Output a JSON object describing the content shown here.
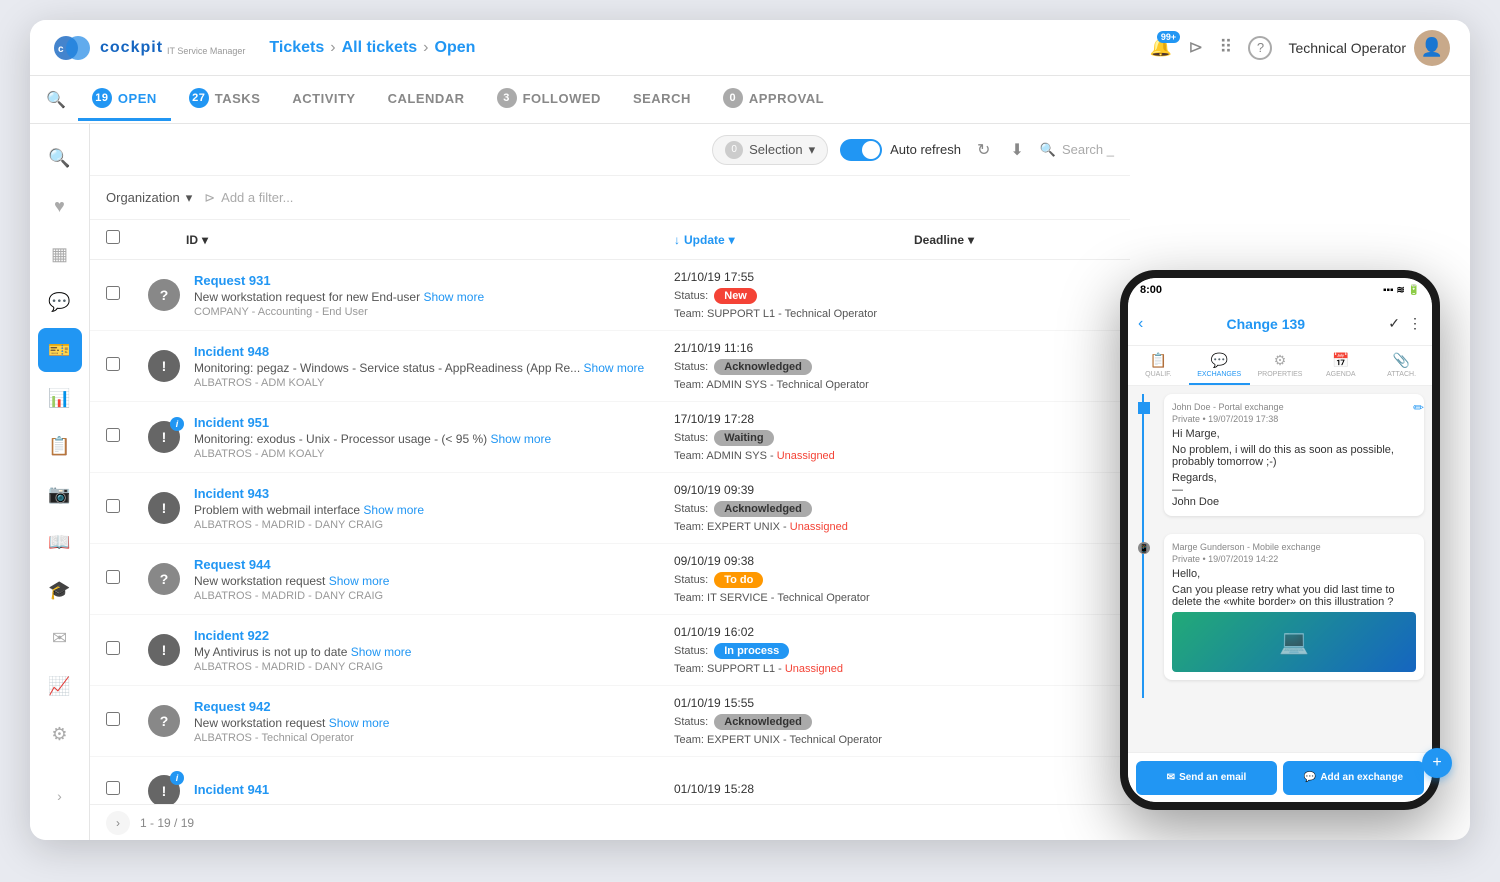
{
  "app": {
    "title": "cockpit IT Service Manager",
    "breadcrumb": {
      "part1": "Tickets",
      "part2": "All tickets",
      "part3": "Open"
    }
  },
  "header": {
    "notification_badge": "99+",
    "user_name": "Technical Operator"
  },
  "nav": {
    "tabs": [
      {
        "id": "open",
        "label": "OPEN",
        "badge": "19",
        "active": true
      },
      {
        "id": "tasks",
        "label": "TASKS",
        "badge": "27",
        "active": false
      },
      {
        "id": "activity",
        "label": "ACTIVITY",
        "badge": "",
        "active": false
      },
      {
        "id": "calendar",
        "label": "CALENDAR",
        "badge": "",
        "active": false
      },
      {
        "id": "followed",
        "label": "FOLLOWED",
        "badge": "3",
        "active": false
      },
      {
        "id": "search",
        "label": "SEARCH",
        "badge": "",
        "active": false
      },
      {
        "id": "approval",
        "label": "APPROVAL",
        "badge": "0",
        "active": false
      }
    ]
  },
  "toolbar": {
    "selection_label": "Selection",
    "selection_count": "0",
    "auto_refresh_label": "Auto refresh",
    "search_placeholder": "Search _"
  },
  "filter": {
    "org_label": "Organization",
    "add_filter_label": "Add a filter..."
  },
  "table": {
    "col_id": "ID",
    "col_update": "Update",
    "col_deadline": "Deadline",
    "tickets": [
      {
        "id": "Request 931",
        "avatar_type": "question",
        "desc": "New workstation request for new End-user Show more",
        "org": "COMPANY - Accounting - End User",
        "date": "21/10/19 17:55",
        "status": "New",
        "status_type": "new",
        "team": "SUPPORT L1 - Technical Operator",
        "unassigned": false
      },
      {
        "id": "Incident 948",
        "avatar_type": "exclamation",
        "desc": "Monitoring: pegaz - Windows - Service status - AppReadiness (App Re... Show more",
        "org": "ALBATROS - ADM KOALY",
        "date": "21/10/19 11:16",
        "status": "Acknowledged",
        "status_type": "acknowledged",
        "team": "ADMIN SYS - Technical Operator",
        "unassigned": false
      },
      {
        "id": "Incident 951",
        "avatar_type": "exclamation",
        "info_badge": true,
        "desc": "Monitoring: exodus - Unix - Processor usage - (< 95 %) Show more",
        "org": "ALBATROS - ADM KOALY",
        "date": "17/10/19 17:28",
        "status": "Waiting",
        "status_type": "waiting",
        "team": "ADMIN SYS - Unassigned",
        "unassigned": true
      },
      {
        "id": "Incident 943",
        "avatar_type": "exclamation",
        "desc": "Problem with webmail interface Show more",
        "org": "ALBATROS - MADRID - DANY CRAIG",
        "date": "09/10/19 09:39",
        "status": "Acknowledged",
        "status_type": "acknowledged",
        "team": "EXPERT UNIX - Unassigned",
        "unassigned": true
      },
      {
        "id": "Request 944",
        "avatar_type": "question",
        "desc": "New workstation request Show more",
        "org": "ALBATROS - MADRID - DANY CRAIG",
        "date": "09/10/19 09:38",
        "status": "To do",
        "status_type": "todo",
        "team": "IT SERVICE - Technical Operator",
        "unassigned": false
      },
      {
        "id": "Incident 922",
        "avatar_type": "exclamation",
        "desc": "My Antivirus is not up to date Show more",
        "org": "ALBATROS - MADRID - DANY CRAIG",
        "date": "01/10/19 16:02",
        "status": "In process",
        "status_type": "inprocess",
        "team": "SUPPORT L1 - Unassigned",
        "unassigned": true
      },
      {
        "id": "Request 942",
        "avatar_type": "question",
        "desc": "New workstation request Show more",
        "org": "ALBATROS - Technical Operator",
        "date": "01/10/19 15:55",
        "status": "Acknowledged",
        "status_type": "acknowledged",
        "team": "EXPERT UNIX - Technical Operator",
        "unassigned": false
      },
      {
        "id": "Incident 941",
        "avatar_type": "exclamation",
        "info_badge": true,
        "desc": "",
        "org": "",
        "date": "01/10/19 15:28",
        "status": "",
        "status_type": "",
        "team": "",
        "unassigned": false
      }
    ]
  },
  "footer": {
    "pagination": "1 - 19 / 19"
  },
  "phone": {
    "time": "8:00",
    "title": "Change 139",
    "tabs": [
      "QUALIFICATION",
      "EXCHANGES",
      "PROPERTIES",
      "AGENDA",
      "ATTACHMENTS"
    ],
    "active_tab": "EXCHANGES",
    "msg1_sender": "John Doe - Portal exchange",
    "msg1_meta": "Private • 19/07/2019 17:38",
    "msg1_greeting": "Hi Marge,",
    "msg1_body": "No problem, i will do this as soon as possible, probably tomorrow ;-)",
    "msg1_regards": "Regards,",
    "msg1_sign": "—\nJohn Doe",
    "msg2_sender": "Marge Gunderson - Mobile exchange",
    "msg2_meta": "Private • 19/07/2019 14:22",
    "msg2_greeting": "Hello,",
    "msg2_body": "Can you please retry what you did last time to delete the «white border» on this illustration ?",
    "btn_email": "Send an email",
    "btn_exchange": "Add an exchange"
  },
  "icons": {
    "chevron_down": "▾",
    "chevron_right": "›",
    "sort_down": "↓",
    "filter": "⊳",
    "search": "🔍",
    "refresh": "↻",
    "download": "⬇",
    "more_vert": "⋮",
    "back": "‹",
    "check": "✓",
    "grid": "⠿",
    "help": "?",
    "mail": "✉",
    "chat": "💬",
    "edit": "✏",
    "plus": "+",
    "heart": "♥",
    "dashboard": "▦",
    "tickets_icon": "🎫",
    "stats": "📊",
    "settings": "⚙",
    "camera": "📷",
    "book": "📖",
    "graduation": "🎓",
    "envelope": "✉",
    "chart": "📈"
  }
}
